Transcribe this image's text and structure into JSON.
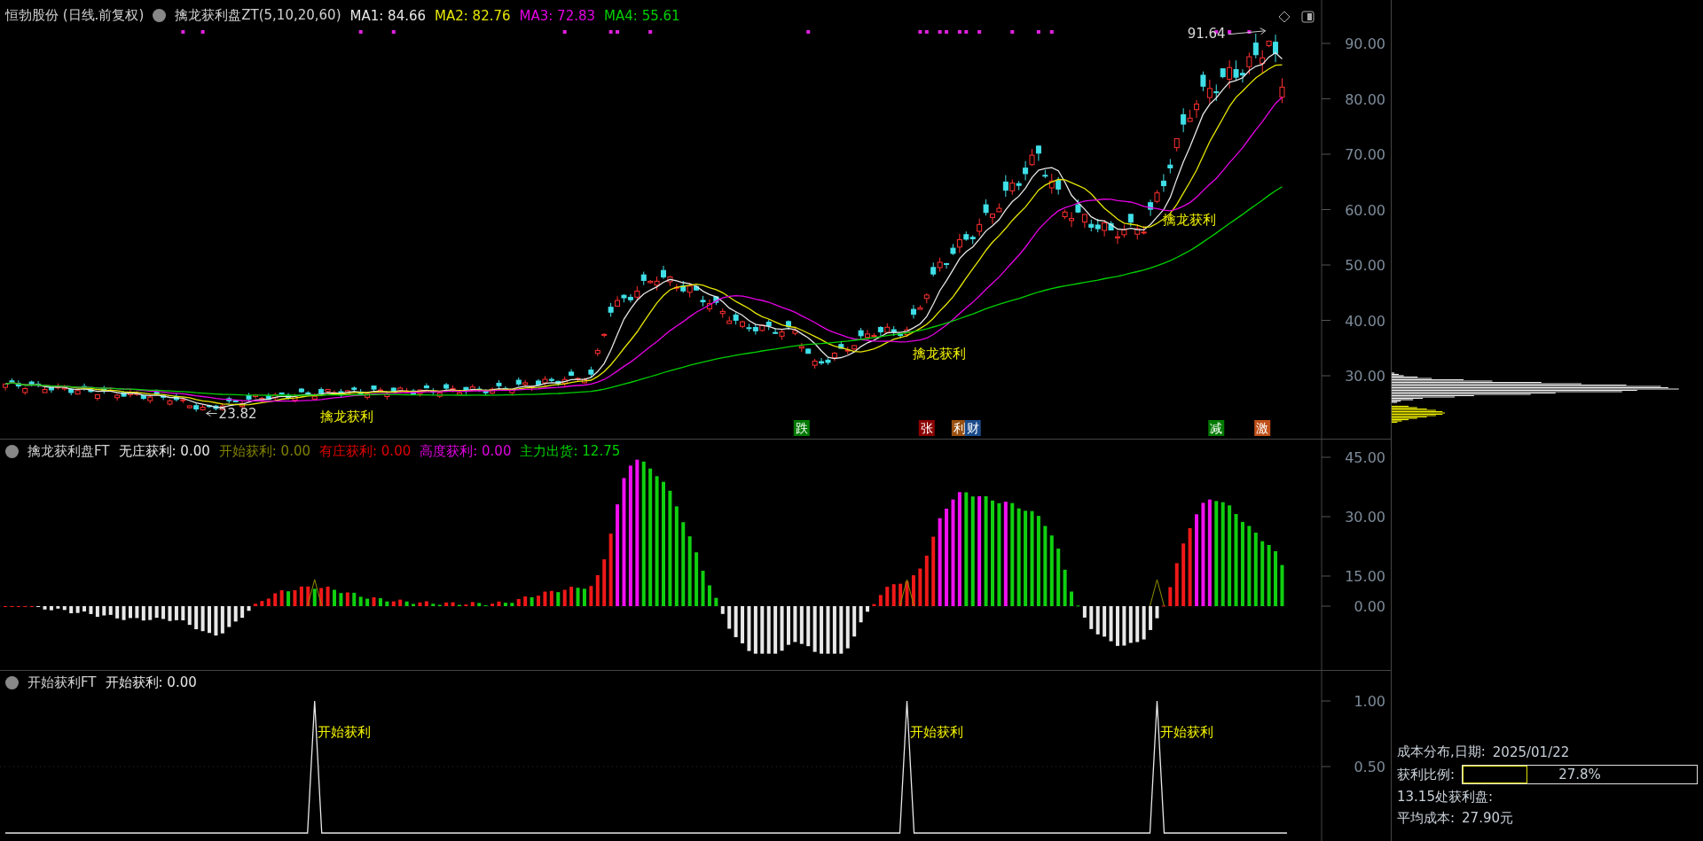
{
  "main_panel": {
    "stock_title": "恒勃股份 (日线.前复权)",
    "indicator_name": "擒龙获利盘ZT(5,10,20,60)",
    "legend": [
      {
        "label": "MA1:",
        "value": "84.66",
        "color": "#e6e6e6"
      },
      {
        "label": "MA2:",
        "value": "82.76",
        "color": "#e6e600"
      },
      {
        "label": "MA3:",
        "value": "72.83",
        "color": "#e600e6"
      },
      {
        "label": "MA4:",
        "value": "55.61",
        "color": "#00d000"
      }
    ],
    "high_label": "91.64",
    "low_label": "23.82",
    "signals": [
      "擒龙获利",
      "擒龙获利",
      "擒龙获利"
    ],
    "event_tags": [
      {
        "label": "跌",
        "color": "#007a00"
      },
      {
        "label": "张",
        "color": "#8b0000"
      },
      {
        "label": "利",
        "color": "#9a5010"
      },
      {
        "label": "财",
        "color": "#1a4a8a"
      },
      {
        "label": "减",
        "color": "#007a00"
      },
      {
        "label": "激",
        "color": "#c05018"
      }
    ],
    "axis_labels": [
      "90.00",
      "80.00",
      "70.00",
      "60.00",
      "50.00",
      "40.00",
      "30.00"
    ]
  },
  "indicator_panel": {
    "name": "擒龙获利盘FT",
    "legend": [
      {
        "label": "无庄获利:",
        "value": "0.00",
        "color": "#e6e6e6"
      },
      {
        "label": "开始获利:",
        "value": "0.00",
        "color": "#808000"
      },
      {
        "label": "有庄获利:",
        "value": "0.00",
        "color": "#e00000"
      },
      {
        "label": "高度获利:",
        "value": "0.00",
        "color": "#e000e0"
      },
      {
        "label": "主力出货:",
        "value": "12.75",
        "color": "#00d000"
      }
    ],
    "axis_labels": [
      "45.00",
      "30.00",
      "15.00",
      "0.00"
    ]
  },
  "start_panel": {
    "name": "开始获利FT",
    "legend": [
      {
        "label": "开始获利:",
        "value": "0.00",
        "color": "#e6e6e6"
      }
    ],
    "signals": [
      "开始获利",
      "开始获利",
      "开始获利"
    ],
    "axis_labels": [
      "1.00",
      "0.50"
    ]
  },
  "cost_panel": {
    "date_label": "成本分布,日期:",
    "date": "2025/01/22",
    "profit_label": "获利比例:",
    "profit_ratio": {
      "level": 0.278,
      "reading": "27.8%"
    },
    "profit_line": "13.15处获利盘:",
    "avg_cost_label": "平均成本:",
    "avg_cost": "27.90元"
  }
}
